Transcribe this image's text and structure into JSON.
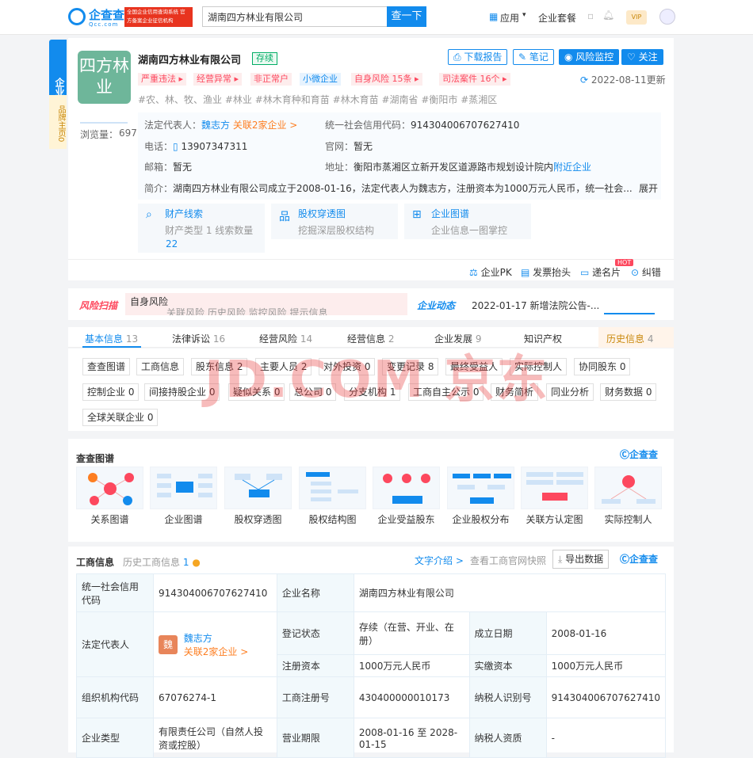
{
  "topbar": {
    "logo_text": "企查查",
    "logo_sub": "Qcc.com",
    "logo_badge": "全国企业信用查询系统 官方备案企业征信机构",
    "search_value": "湖南四方林业有限公司",
    "search_btn": "查一下",
    "nav": [
      "应用",
      "企业套餐"
    ],
    "vip": "VIP"
  },
  "sidebar": {
    "main_tab": "企业主页",
    "brand_tab": "品牌主页",
    "brand_count": "0"
  },
  "company": {
    "logo": "四方林业",
    "name": "湖南四方林业有限公司",
    "status": "存续",
    "tags": [
      "严重违法 ▸",
      "经营异常 ▸",
      "非正常户",
      "小微企业",
      "自身风险 15条 ▸",
      "司法案件 16个 ▸"
    ],
    "hashtags": "#农、林、牧、渔业 #林业 #林木育种和育苗 #林木育苗 #湖南省 #衡阳市 #蒸湘区",
    "views_label": "浏览量：",
    "views": "697",
    "updated": "2022-08-11更新",
    "legal_label": "法定代表人：",
    "legal": "魏志方",
    "related": "关联2家企业 >",
    "credit_label": "统一社会信用代码：",
    "credit": "914304006707627410",
    "phone_label": "电话：",
    "phone": "13907347311",
    "web_label": "官网：",
    "web": "暂无",
    "email_label": "邮箱：",
    "email": "暂无",
    "addr_label": "地址：",
    "addr": "衡阳市蒸湘区立新开发区道源路市规划设计院内",
    "nearby": "附近企业",
    "intro_label": "简介：",
    "intro": "湖南四方林业有限公司成立于2008-01-16，法定代表人为魏志方，注册资本为1000万元人民币，统一社会...",
    "expand": "展开"
  },
  "actions": [
    "下载报告",
    "笔记",
    "风险监控",
    "关注"
  ],
  "features": [
    {
      "title": "财产线索",
      "desc": "财产类型 1  线索数量",
      "extra": "22"
    },
    {
      "title": "股权穿透图",
      "desc": "挖掘深层股权结构",
      "extra": ""
    },
    {
      "title": "企业图谱",
      "desc": "企业信息一图掌控",
      "extra": ""
    }
  ],
  "tools": [
    "企业PK",
    "发票抬头",
    "递名片",
    "纠错"
  ],
  "hot": "HOT",
  "risk": {
    "label": "风险扫描",
    "item1": "自身风险",
    "item2": "关联风险  历史风险  监控风险  提示信息",
    "dyn_label": "企业动态",
    "dyn": "2022-01-17 新增法院公告-..."
  },
  "tabs": [
    {
      "label": "基本信息",
      "count": "13"
    },
    {
      "label": "法律诉讼",
      "count": "16"
    },
    {
      "label": "经营风险",
      "count": "14"
    },
    {
      "label": "经营信息",
      "count": "2"
    },
    {
      "label": "企业发展",
      "count": "9"
    },
    {
      "label": "知识产权",
      "count": ""
    },
    {
      "label": "历史信息",
      "count": "4"
    }
  ],
  "chips_row1": [
    "查查图谱",
    "工商信息",
    "股东信息 2",
    "主要人员 2",
    "对外投资 0",
    "变更记录 8",
    "最终受益人",
    "实际控制人",
    "协同股东 0"
  ],
  "chips_row2": [
    "控制企业 0",
    "间接持股企业 0",
    "疑似关系 0",
    "总公司 0",
    "分支机构 1",
    "工商自主公示 0",
    "财务简析",
    "同业分析",
    "财务数据 0"
  ],
  "chips_row3": [
    "全球关联企业 0"
  ],
  "graphs": {
    "title": "查查图谱",
    "brand": "企查查",
    "items": [
      "关系图谱",
      "企业图谱",
      "股权穿透图",
      "股权结构图",
      "企业受益股东",
      "企业股权分布",
      "关联方认定图",
      "实际控制人"
    ]
  },
  "biz": {
    "title": "工商信息",
    "history": "历史工商信息",
    "history_count": "1",
    "text_intro": "文字介绍 >",
    "snapshot": "查看工商官网快照",
    "export": "导出数据",
    "brand": "企查查",
    "rows": {
      "credit_h": "统一社会信用代码",
      "credit": "914304006707627410",
      "name_h": "企业名称",
      "name": "湖南四方林业有限公司",
      "legal_h": "法定代表人",
      "avatar": "魏",
      "legal": "魏志方",
      "legal_rel": "关联2家企业 >",
      "reg_status_h": "登记状态",
      "reg_status": "存续（在营、开业、在册）",
      "found_h": "成立日期",
      "found": "2008-01-16",
      "capital_h": "注册资本",
      "capital": "1000万元人民币",
      "paid_h": "实缴资本",
      "paid": "1000万元人民币",
      "org_h": "组织机构代码",
      "org": "67076274-1",
      "regno_h": "工商注册号",
      "regno": "430400000010173",
      "tax_h": "纳税人识别号",
      "tax": "914304006707627410",
      "type_h": "企业类型",
      "type": "有限责任公司（自然人投资或控股）",
      "term_h": "营业期限",
      "term": "2008-01-16 至 2028-01-15",
      "taxq_h": "纳税人资质",
      "taxq": "-"
    }
  },
  "watermark": "JD.COM 京东"
}
